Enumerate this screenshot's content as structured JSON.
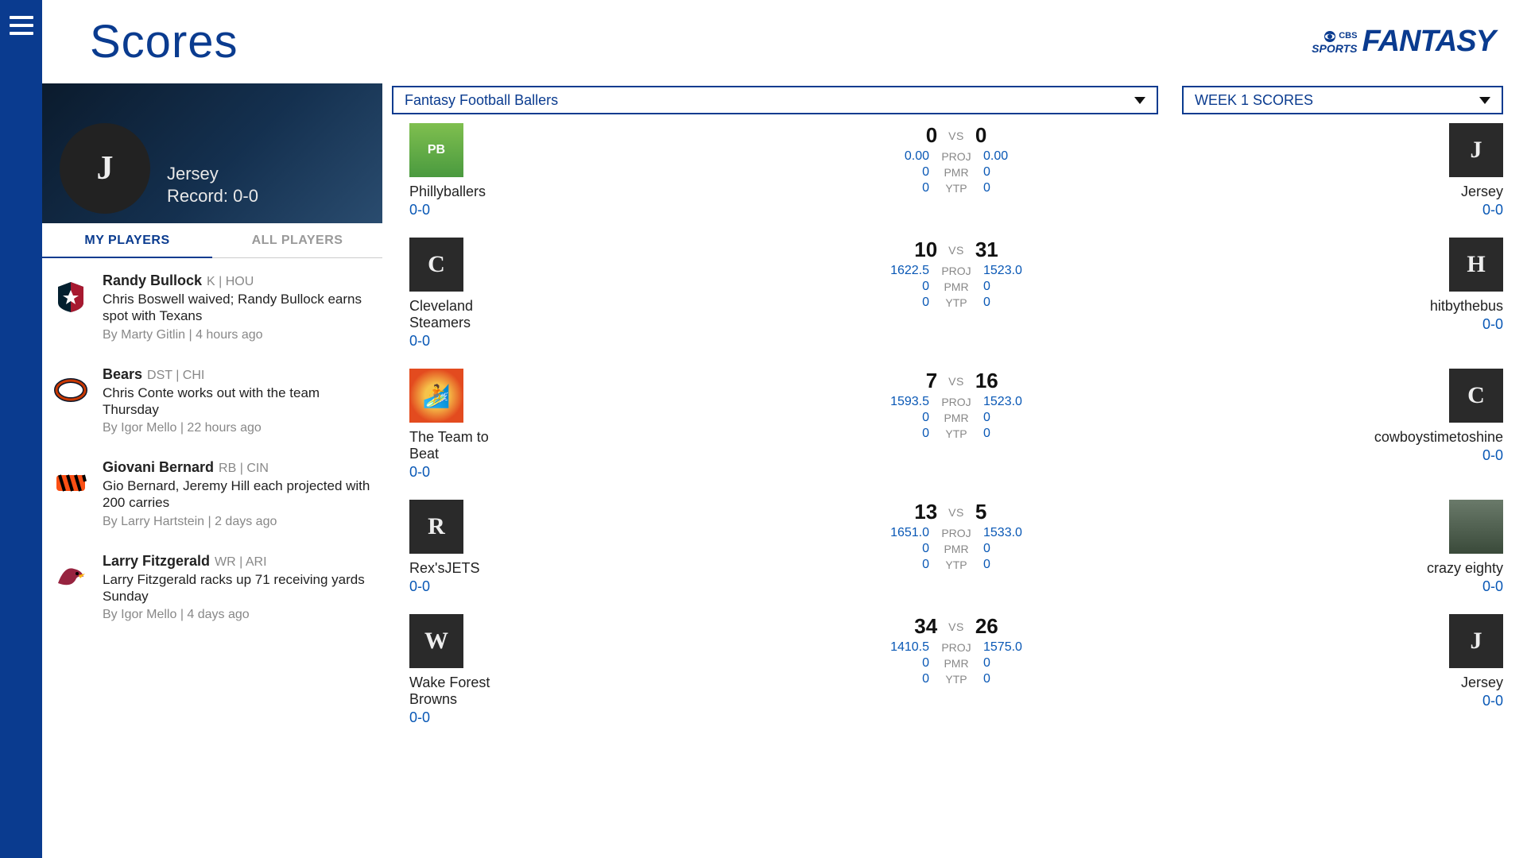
{
  "page_title": "Scores",
  "brand": {
    "cbs": "CBS",
    "sports": "SPORTS",
    "fantasy": "FANTASY"
  },
  "hero": {
    "letter": "J",
    "name": "Jersey",
    "record": "Record: 0-0"
  },
  "tabs": {
    "my_players": "MY PLAYERS",
    "all_players": "ALL PLAYERS"
  },
  "news": [
    {
      "player": "Randy Bullock",
      "pos": "K | HOU",
      "headline": "Chris Boswell waived; Randy Bullock earns spot with Texans",
      "byline": "By Marty Gitlin | 4 hours ago",
      "logo": "texans"
    },
    {
      "player": "Bears",
      "pos": "DST | CHI",
      "headline": "Chris Conte works out with the team Thursday",
      "byline": "By Igor Mello | 22 hours ago",
      "logo": "bears"
    },
    {
      "player": "Giovani Bernard",
      "pos": "RB | CIN",
      "headline": "Gio Bernard, Jeremy Hill each projected with 200 carries",
      "byline": "By Larry Hartstein | 2 days ago",
      "logo": "bengals"
    },
    {
      "player": "Larry Fitzgerald",
      "pos": "WR | ARI",
      "headline": "Larry Fitzgerald racks up 71 receiving yards Sunday",
      "byline": "By Igor Mello | 4 days ago",
      "logo": "cardinals"
    }
  ],
  "dropdowns": {
    "league": "Fantasy Football Ballers",
    "week": "WEEK 1 SCORES"
  },
  "labels": {
    "vs": "VS",
    "proj": "PROJ",
    "pmr": "PMR",
    "ytp": "YTP"
  },
  "matchups": [
    {
      "left": {
        "name": "Phillyballers",
        "rec": "0-0",
        "avatar": "pb"
      },
      "right": {
        "name": "Jersey",
        "rec": "0-0",
        "avatar": "J"
      },
      "scoreL": "0",
      "scoreR": "0",
      "projL": "0.00",
      "projR": "0.00",
      "pmrL": "0",
      "pmrR": "0",
      "ytpL": "0",
      "ytpR": "0"
    },
    {
      "left": {
        "name": "Cleveland Steamers",
        "rec": "0-0",
        "avatar": "C"
      },
      "right": {
        "name": "hitbythebus",
        "rec": "0-0",
        "avatar": "H"
      },
      "scoreL": "10",
      "scoreR": "31",
      "projL": "1622.5",
      "projR": "1523.0",
      "pmrL": "0",
      "pmrR": "0",
      "ytpL": "0",
      "ytpR": "0"
    },
    {
      "left": {
        "name": "The Team to Beat",
        "rec": "0-0",
        "avatar": "surfer"
      },
      "right": {
        "name": "cowboystimetoshine",
        "rec": "0-0",
        "avatar": "C"
      },
      "scoreL": "7",
      "scoreR": "16",
      "projL": "1593.5",
      "projR": "1523.0",
      "pmrL": "0",
      "pmrR": "0",
      "ytpL": "0",
      "ytpR": "0"
    },
    {
      "left": {
        "name": "Rex'sJETS",
        "rec": "0-0",
        "avatar": "R"
      },
      "right": {
        "name": "crazy eighty",
        "rec": "0-0",
        "avatar": "photo"
      },
      "scoreL": "13",
      "scoreR": "5",
      "projL": "1651.0",
      "projR": "1533.0",
      "pmrL": "0",
      "pmrR": "0",
      "ytpL": "0",
      "ytpR": "0"
    },
    {
      "left": {
        "name": "Wake Forest Browns",
        "rec": "0-0",
        "avatar": "W"
      },
      "right": {
        "name": "Jersey",
        "rec": "0-0",
        "avatar": "J"
      },
      "scoreL": "34",
      "scoreR": "26",
      "projL": "1410.5",
      "projR": "1575.0",
      "pmrL": "0",
      "pmrR": "0",
      "ytpL": "0",
      "ytpR": "0"
    }
  ]
}
